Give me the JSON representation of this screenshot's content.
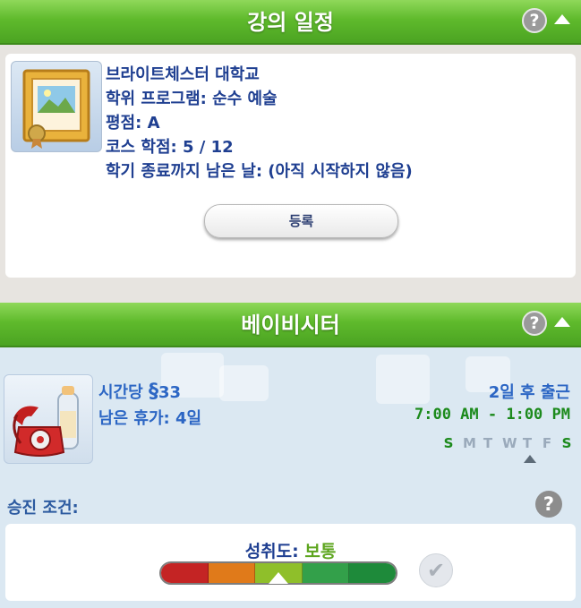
{
  "course_panel": {
    "title": "강의 일정",
    "help_icon_label": "?",
    "lines": [
      "브라이트체스터 대학교",
      "학위 프로그램: 순수 예술",
      "평점: A",
      "코스 학점: 5 / 12",
      "학기 종료까지 남은 날: (아직 시작하지 않음)"
    ],
    "enroll_label": "등록"
  },
  "job_panel": {
    "title": "베이비시터",
    "help_icon_label": "?",
    "pay_prefix": "시간당 ",
    "pay_symbol": "§",
    "pay_amount": "33",
    "vacation": "남은 휴가: 4일",
    "next_work": "2일 후 출근",
    "hours": "7:00 AM - 1:00 PM",
    "days": [
      {
        "label": "S",
        "work": true
      },
      {
        "label": "M",
        "work": false
      },
      {
        "label": "T",
        "work": false
      },
      {
        "label": "W",
        "work": false
      },
      {
        "label": "T",
        "work": false
      },
      {
        "label": "F",
        "work": false
      },
      {
        "label": "S",
        "work": true
      }
    ]
  },
  "promotion": {
    "label": "승진 조건:",
    "help_icon_label": "?",
    "performance_label": "성취도: ",
    "performance_value": "보통",
    "meter_colors": [
      "#c42424",
      "#e07a1a",
      "#8fbf2a",
      "#33a04a",
      "#1e8a3a"
    ],
    "meter_level": 0.5,
    "check_icon": "✔"
  },
  "colors": {
    "header_green": "#5fba2c",
    "text_navy": "#1f3f91",
    "text_blue": "#2c66c4",
    "work_green": "#1c8a1c"
  }
}
